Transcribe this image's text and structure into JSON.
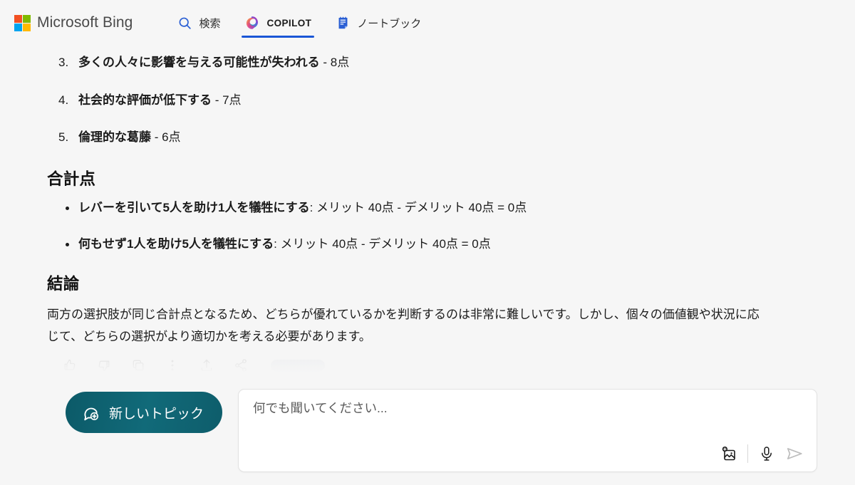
{
  "header": {
    "brand": "Microsoft Bing",
    "logo_icon": "microsoft-logo-icon",
    "nav": [
      {
        "label": "検索",
        "icon": "search-icon",
        "active": false
      },
      {
        "label": "COPILOT",
        "icon": "copilot-icon",
        "active": true
      },
      {
        "label": "ノートブック",
        "icon": "notebook-icon",
        "active": false
      }
    ]
  },
  "content": {
    "numbered_items": [
      {
        "marker": "3.",
        "bold": "多くの人々に影響を与える可能性が失われる",
        "points": " - 8点"
      },
      {
        "marker": "4.",
        "bold": "社会的な評価が低下する",
        "points": " - 7点"
      },
      {
        "marker": "5.",
        "bold": "倫理的な葛藤",
        "points": " - 6点"
      }
    ],
    "total_heading": "合計点",
    "total_items": [
      {
        "bold": "レバーを引いて5人を助け1人を犠牲にする",
        "rest": ": メリット 40点 - デメリット 40点 = 0点"
      },
      {
        "bold": "何もせず1人を助け5人を犠牲にする",
        "rest": ": メリット 40点 - デメリット 40点 = 0点"
      }
    ],
    "conclusion_heading": "結論",
    "conclusion_text": "両方の選択肢が同じ合計点となるため、どちらが優れているかを判断するのは非常に難しいです。しかし、個々の価値観や状況に応じて、どちらの選択がより適切かを考える必要があります。",
    "action_icons": [
      "thumbs-up-icon",
      "thumbs-down-icon",
      "copy-icon",
      "more-icon",
      "export-icon",
      "share-icon"
    ]
  },
  "composer": {
    "new_topic_label": "新しいトピック",
    "new_topic_icon": "new-chat-icon",
    "input_placeholder": "何でも聞いてください...",
    "input_value": "",
    "add_image_icon": "add-image-icon",
    "mic_icon": "microphone-icon",
    "send_icon": "send-icon"
  },
  "colors": {
    "page_bg": "#f6f6f6",
    "accent_blue": "#1a56d6",
    "teal_button": "#0f5f6b",
    "text": "#1b1b1b"
  }
}
